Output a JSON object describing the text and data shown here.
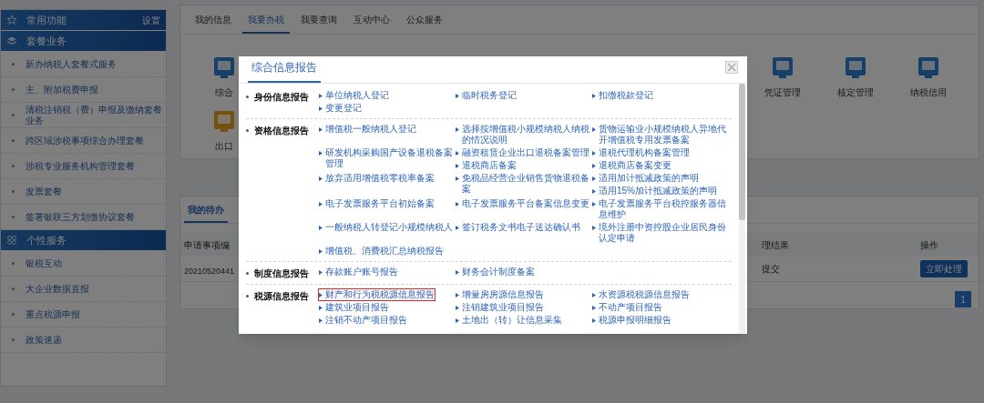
{
  "sidebar": {
    "sections": [
      {
        "title": "常用功能",
        "action": "设置"
      },
      {
        "title": "套餐业务",
        "items": [
          "新办纳税人套餐式服务",
          "主、附加税费申报",
          "清税注销税（费）申报及缴纳套餐业务",
          "跨区域涉税事项综合办理套餐",
          "涉税专业服务机构管理套餐",
          "发票套餐",
          "签署银联三方划缴协议套餐"
        ]
      },
      {
        "title": "个性服务",
        "items": [
          "银税互动",
          "大企业数据直报",
          "重点税源申报",
          "政策速递"
        ]
      }
    ]
  },
  "tabs": [
    {
      "label": "我的信息",
      "selected": false
    },
    {
      "label": "我要办税",
      "selected": true
    },
    {
      "label": "我要查询",
      "selected": false
    },
    {
      "label": "互动中心",
      "selected": false
    },
    {
      "label": "公众服务",
      "selected": false
    }
  ],
  "services": [
    {
      "label": "综合"
    },
    {
      "label": "凭证管理"
    },
    {
      "label": "核定管理"
    },
    {
      "label": "纳税信用"
    }
  ],
  "services_row_2": [
    {
      "label": "出口"
    }
  ],
  "todo": {
    "tabs": [
      {
        "label": "我的待办",
        "selected": true
      }
    ],
    "columns": [
      "申请事项编",
      "理结果",
      "操作"
    ],
    "rows": [
      {
        "cells": [
          "20210520441",
          "提交"
        ],
        "action": "立即处理"
      }
    ],
    "pages": [
      {
        "label": "1",
        "selected": true
      }
    ]
  },
  "dialog": {
    "title": "综合信息报告",
    "sections": [
      {
        "title": "身份信息报告",
        "links": [
          {
            "text": "单位纳税人登记",
            "highlighted": false
          },
          {
            "text": "临时税务登记",
            "highlighted": false
          },
          {
            "text": "扣缴税款登记",
            "highlighted": false
          },
          {
            "text": "变更登记",
            "highlighted": false
          }
        ]
      },
      {
        "title": "资格信息报告",
        "links": [
          {
            "text": "增值税一般纳税人登记",
            "highlighted": false
          },
          {
            "text": "选择按增值税小规模纳税人纳税的情况说明",
            "highlighted": false
          },
          {
            "text": "货物运输业小规模纳税人异地代开增值税专用发票备案",
            "highlighted": false
          },
          {
            "text": "研发机构采购国产设备退税备案管理",
            "highlighted": false
          },
          {
            "text": "融资租赁企业出口退税备案管理",
            "highlighted": false
          },
          {
            "text": "退税代理机构备案管理",
            "highlighted": false
          },
          {
            "text": "退税商店备案",
            "highlighted": false
          },
          {
            "text": "退税商店备案变更",
            "highlighted": false
          },
          {
            "text": "放弃适用增值税零税率备案",
            "highlighted": false
          },
          {
            "text": "免税品经营企业销售货物退税备案",
            "highlighted": false
          },
          {
            "text": "适用加计抵减政策的声明",
            "highlighted": false
          },
          {
            "text": "适用15%加计抵减政策的声明",
            "highlighted": false
          },
          {
            "text": "电子发票服务平台初始备案",
            "highlighted": false
          },
          {
            "text": "电子发票服务平台备案信息变更",
            "highlighted": false
          },
          {
            "text": "电子发票服务平台税控服务器信息维护",
            "highlighted": false
          },
          {
            "text": "一般纳税人转登记小规模纳税人",
            "highlighted": false
          },
          {
            "text": "签订税务文书电子送达确认书",
            "highlighted": false
          },
          {
            "text": "境外注册中资控股企业居民身份认定申请",
            "highlighted": false
          },
          {
            "text": "增值税、消费税汇总纳税报告",
            "highlighted": false
          }
        ]
      },
      {
        "title": "制度信息报告",
        "links": [
          {
            "text": "存款账户账号报告",
            "highlighted": false
          },
          {
            "text": "财务会计制度备案",
            "highlighted": false
          }
        ]
      },
      {
        "title": "税源信息报告",
        "links": [
          {
            "text": "财产和行为税税源信息报告",
            "highlighted": true
          },
          {
            "text": "增量房房源信息报告",
            "highlighted": false
          },
          {
            "text": "水资源税税源信息报告",
            "highlighted": false
          },
          {
            "text": "建筑业项目报告",
            "highlighted": false
          },
          {
            "text": "注销建筑业项目报告",
            "highlighted": false
          },
          {
            "text": "不动产项目报告",
            "highlighted": false
          },
          {
            "text": "注销不动产项目报告",
            "highlighted": false
          },
          {
            "text": "土地出（转）让信息采集",
            "highlighted": false
          },
          {
            "text": "税源申报明细报告",
            "highlighted": false
          }
        ]
      }
    ]
  }
}
